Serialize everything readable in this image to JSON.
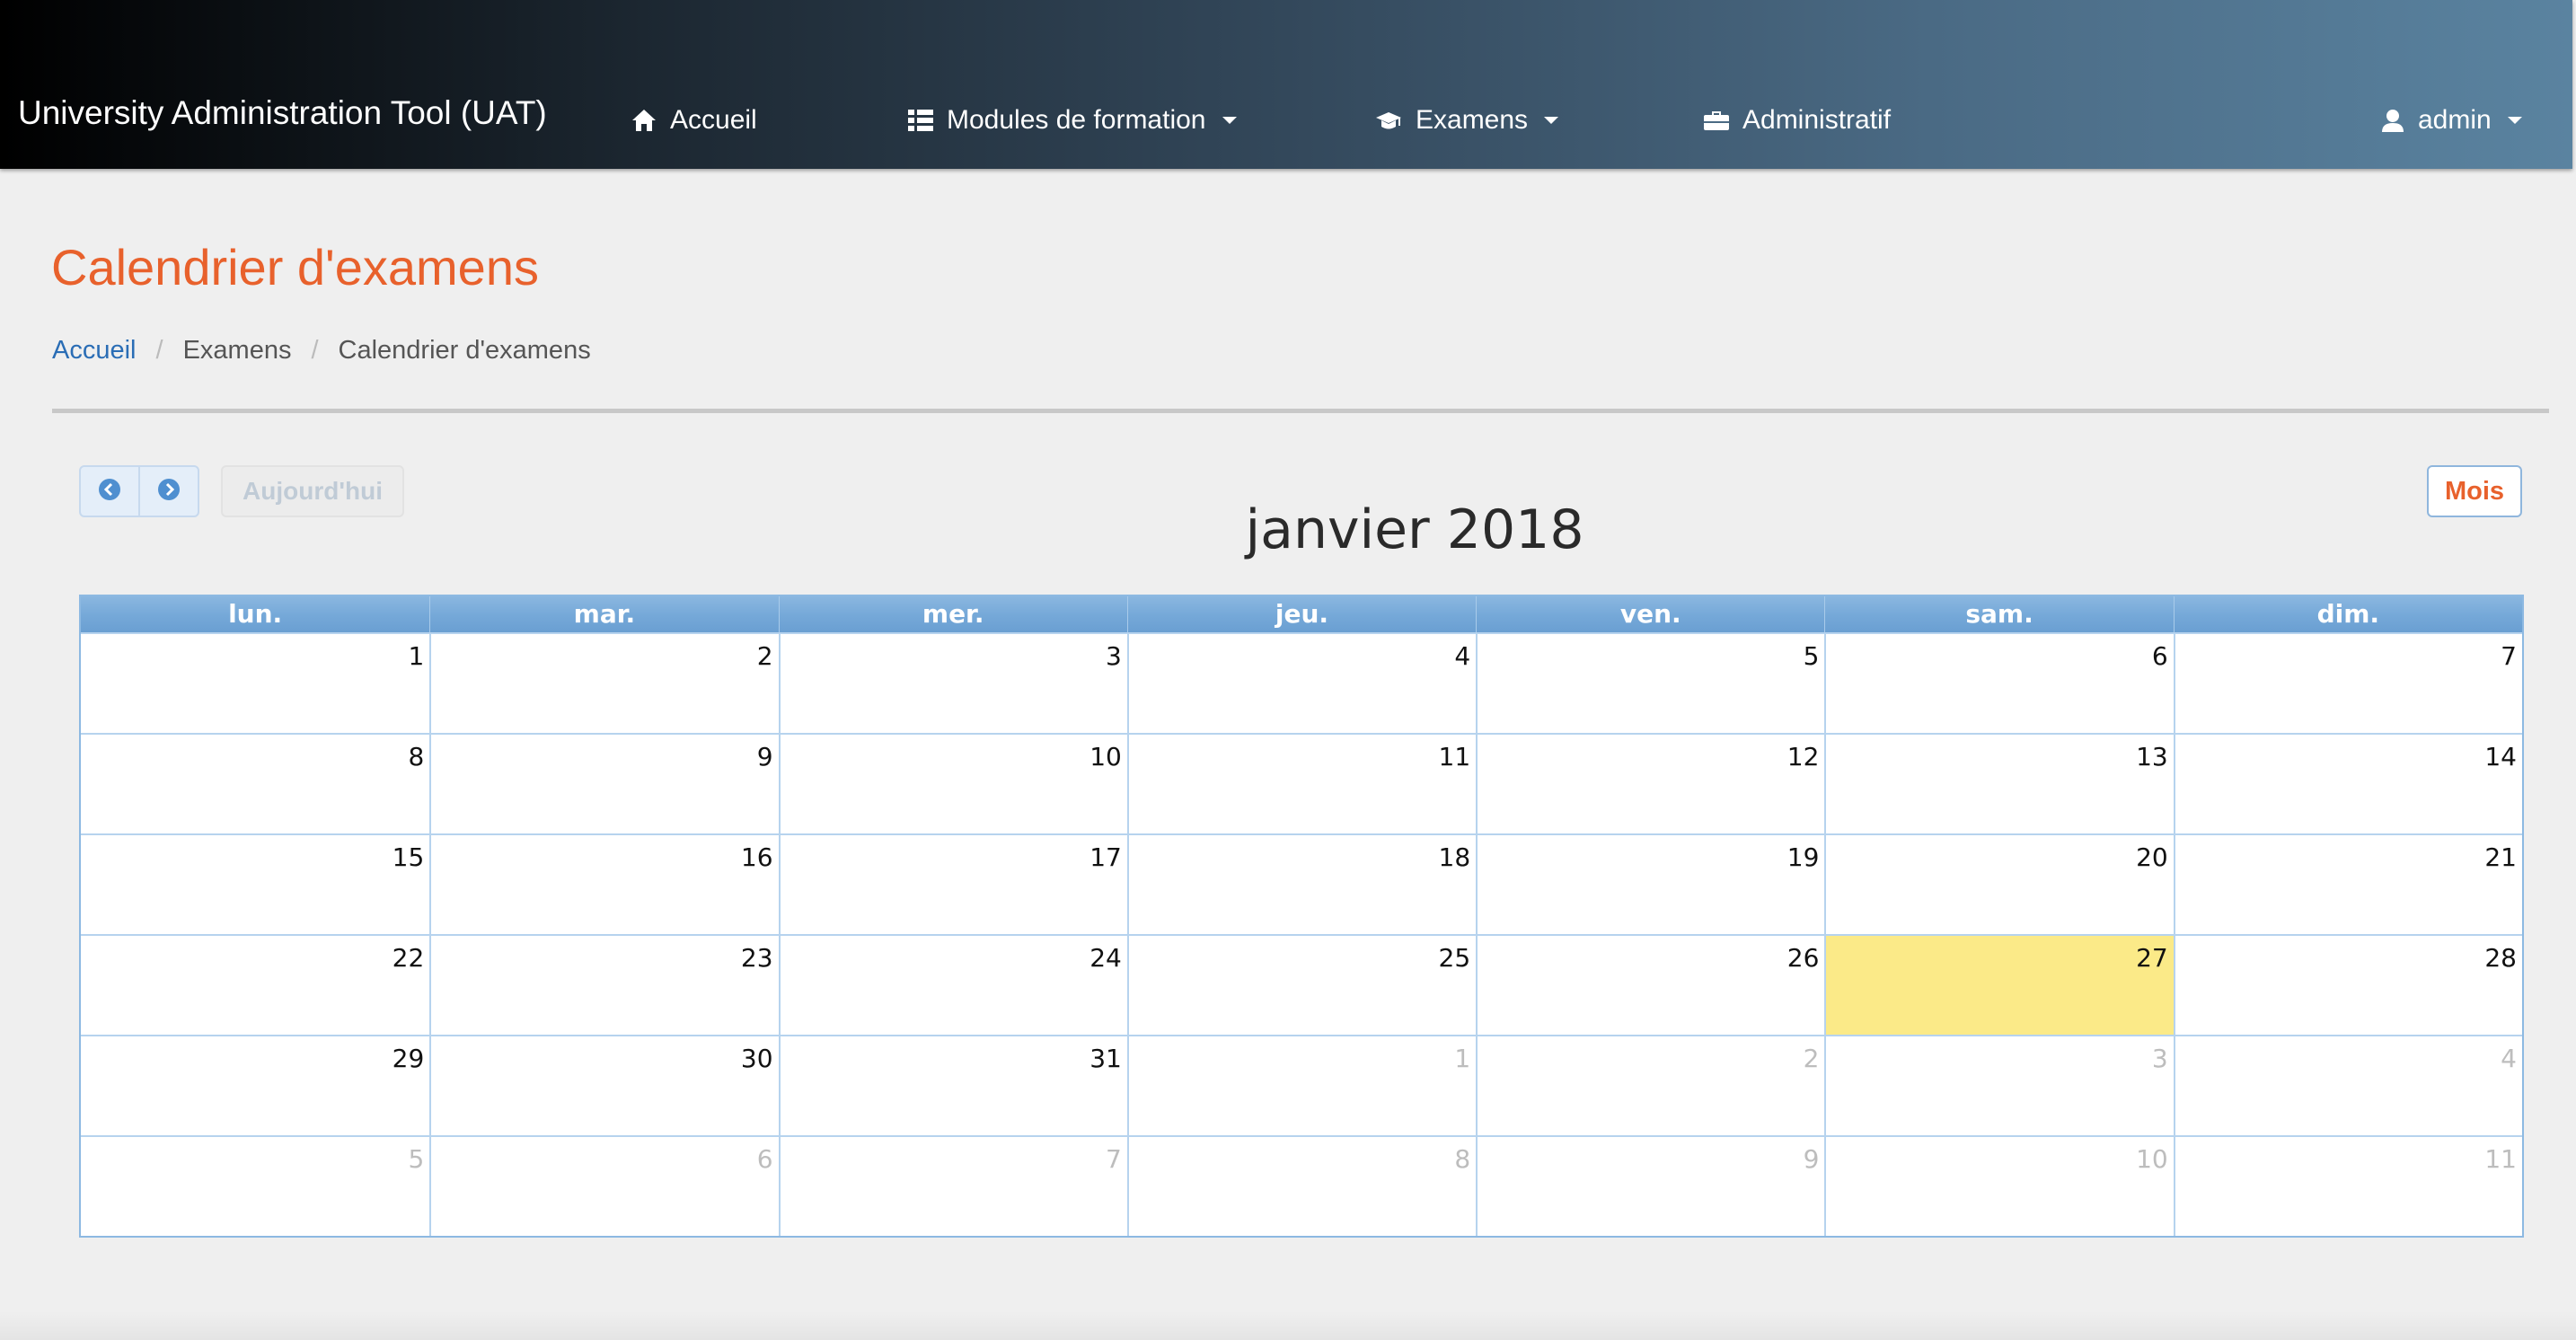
{
  "navbar": {
    "brand": "University Administration Tool (UAT)",
    "items": [
      {
        "label": "Accueil",
        "icon": "home-icon",
        "dropdown": false
      },
      {
        "label": "Modules de formation",
        "icon": "list-icon",
        "dropdown": true
      },
      {
        "label": "Examens",
        "icon": "graduation-cap-icon",
        "dropdown": true
      },
      {
        "label": "Administratif",
        "icon": "briefcase-icon",
        "dropdown": false
      }
    ],
    "user": {
      "label": "admin",
      "icon": "user-icon",
      "dropdown": true
    }
  },
  "page": {
    "title": "Calendrier d'examens",
    "breadcrumb": [
      "Accueil",
      "Examens",
      "Calendrier d'examens"
    ]
  },
  "calendar": {
    "title": "janvier 2018",
    "today_label": "Aujourd'hui",
    "view_label": "Mois",
    "prev_icon": "chevron-left-circle-icon",
    "next_icon": "chevron-right-circle-icon",
    "weekdays": [
      "lun.",
      "mar.",
      "mer.",
      "jeu.",
      "ven.",
      "sam.",
      "dim."
    ],
    "weeks": [
      [
        {
          "d": "1"
        },
        {
          "d": "2"
        },
        {
          "d": "3"
        },
        {
          "d": "4"
        },
        {
          "d": "5"
        },
        {
          "d": "6"
        },
        {
          "d": "7"
        }
      ],
      [
        {
          "d": "8"
        },
        {
          "d": "9"
        },
        {
          "d": "10"
        },
        {
          "d": "11"
        },
        {
          "d": "12"
        },
        {
          "d": "13"
        },
        {
          "d": "14"
        }
      ],
      [
        {
          "d": "15"
        },
        {
          "d": "16"
        },
        {
          "d": "17"
        },
        {
          "d": "18"
        },
        {
          "d": "19"
        },
        {
          "d": "20"
        },
        {
          "d": "21"
        }
      ],
      [
        {
          "d": "22"
        },
        {
          "d": "23"
        },
        {
          "d": "24"
        },
        {
          "d": "25"
        },
        {
          "d": "26"
        },
        {
          "d": "27",
          "today": true
        },
        {
          "d": "28"
        }
      ],
      [
        {
          "d": "29"
        },
        {
          "d": "30"
        },
        {
          "d": "31"
        },
        {
          "d": "1",
          "other": true
        },
        {
          "d": "2",
          "other": true
        },
        {
          "d": "3",
          "other": true
        },
        {
          "d": "4",
          "other": true
        }
      ],
      [
        {
          "d": "5",
          "other": true
        },
        {
          "d": "6",
          "other": true
        },
        {
          "d": "7",
          "other": true
        },
        {
          "d": "8",
          "other": true
        },
        {
          "d": "9",
          "other": true
        },
        {
          "d": "10",
          "other": true
        },
        {
          "d": "11",
          "other": true
        }
      ]
    ]
  },
  "colors": {
    "accent": "#e8612c",
    "link": "#2a6db5",
    "calendar_header": "#75a8d8",
    "today_highlight": "#fbea88"
  }
}
